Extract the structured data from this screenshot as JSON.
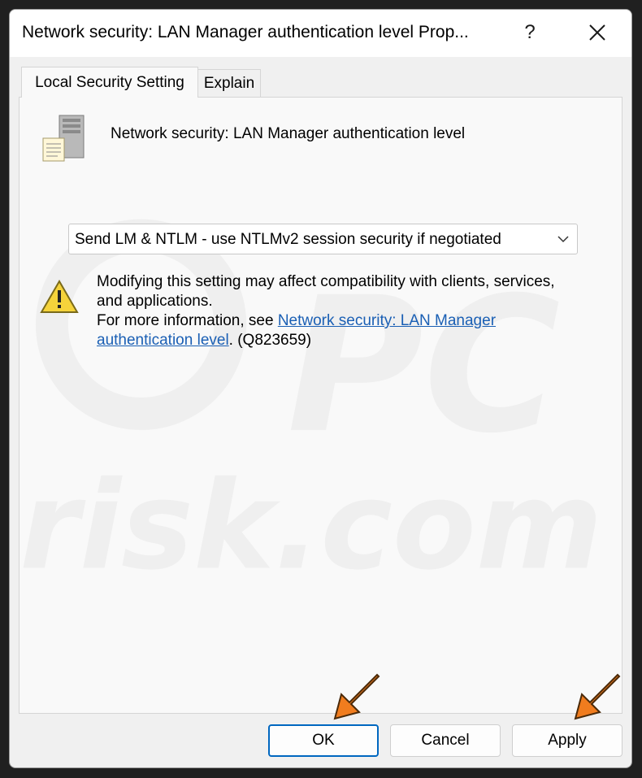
{
  "window": {
    "title": "Network security: LAN Manager authentication level Prop...",
    "help_glyph": "?",
    "close_glyph": "✕"
  },
  "tabs": [
    {
      "label": "Local Security Setting",
      "active": true
    },
    {
      "label": "Explain",
      "active": false
    }
  ],
  "policy": {
    "icon": "server-policy-icon",
    "name": "Network security: LAN Manager authentication level"
  },
  "dropdown": {
    "selected": "Send LM & NTLM - use NTLMv2 session security if negotiated"
  },
  "warning": {
    "icon": "warning-icon",
    "line1": "Modifying this setting may affect compatibility with clients, services, and applications.",
    "info_prefix": "For more information, see ",
    "link_text": "Network security: LAN Manager authentication level",
    "suffix": ". (Q823659)"
  },
  "buttons": {
    "ok": "OK",
    "cancel": "Cancel",
    "apply": "Apply"
  },
  "colors": {
    "link": "#1a5fb4",
    "accent": "#0067c0",
    "arrow": "#f07c1e"
  }
}
